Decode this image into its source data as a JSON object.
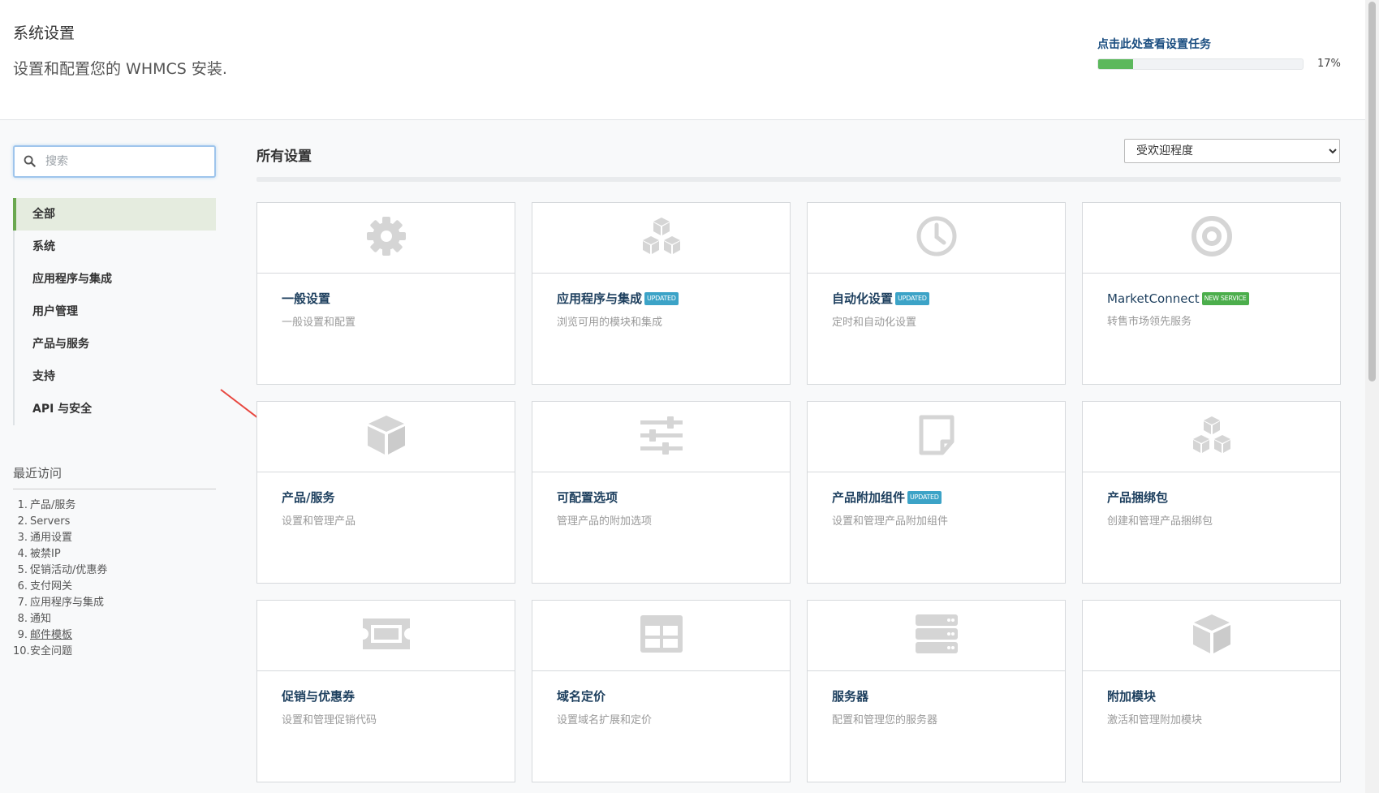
{
  "header": {
    "title": "系统设置",
    "subtitle": "设置和配置您的 WHMCS 安装.",
    "tasks_link": "点击此处查看设置任务",
    "progress": 17,
    "progress_text": "17%"
  },
  "search": {
    "placeholder": "搜索"
  },
  "nav": {
    "items": [
      {
        "label": "全部",
        "active": true
      },
      {
        "label": "系统"
      },
      {
        "label": "应用程序与集成"
      },
      {
        "label": "用户管理"
      },
      {
        "label": "产品与服务"
      },
      {
        "label": "支持"
      },
      {
        "label": "API 与安全"
      }
    ]
  },
  "recent": {
    "title": "最近访问",
    "items": [
      {
        "num": "1.",
        "label": "产品/服务"
      },
      {
        "num": "2.",
        "label": "Servers"
      },
      {
        "num": "3.",
        "label": "通用设置"
      },
      {
        "num": "4.",
        "label": "被禁IP"
      },
      {
        "num": "5.",
        "label": "促销活动/优惠券"
      },
      {
        "num": "6.",
        "label": "支付网关"
      },
      {
        "num": "7.",
        "label": "应用程序与集成"
      },
      {
        "num": "8.",
        "label": "通知"
      },
      {
        "num": "9.",
        "label": "邮件模板"
      },
      {
        "num": "10.",
        "label": "安全问题"
      }
    ]
  },
  "main": {
    "section_title": "所有设置",
    "sort": {
      "selected": "受欢迎程度"
    },
    "cards": [
      {
        "icon": "gear-icon",
        "title": "一般设置",
        "desc": "一般设置和配置"
      },
      {
        "icon": "cubes-icon",
        "title": "应用程序与集成",
        "desc": "浏览可用的模块和集成",
        "badge": "UPDATED"
      },
      {
        "icon": "clock-icon",
        "title": "自动化设置",
        "desc": "定时和自动化设置",
        "badge": "UPDATED"
      },
      {
        "icon": "target-icon",
        "title": "MarketConnect",
        "desc": "转售市场领先服务",
        "badge": "NEW SERVICE"
      },
      {
        "icon": "cube-icon",
        "title": "产品/服务",
        "desc": "设置和管理产品"
      },
      {
        "icon": "sliders-icon",
        "title": "可配置选项",
        "desc": "管理产品的附加选项"
      },
      {
        "icon": "sticky-note-icon",
        "title": "产品附加组件",
        "desc": "设置和管理产品附加组件",
        "badge": "UPDATED"
      },
      {
        "icon": "cubes-icon",
        "title": "产品捆绑包",
        "desc": "创建和管理产品捆绑包"
      },
      {
        "icon": "ticket-icon",
        "title": "促销与优惠券",
        "desc": "设置和管理促销代码"
      },
      {
        "icon": "table-icon",
        "title": "域名定价",
        "desc": "设置域名扩展和定价"
      },
      {
        "icon": "server-icon",
        "title": "服务器",
        "desc": "配置和管理您的服务器"
      },
      {
        "icon": "cube-icon",
        "title": "附加模块",
        "desc": "激活和管理附加模块"
      }
    ]
  },
  "colors": {
    "accent_green": "#5cb85c",
    "badge_updated": "#3ca3c7",
    "badge_new": "#4cae4c",
    "title_blue": "#1d3f5e",
    "icon_gray": "#d5d5d5",
    "annotation_arrow": "#e8473f"
  }
}
